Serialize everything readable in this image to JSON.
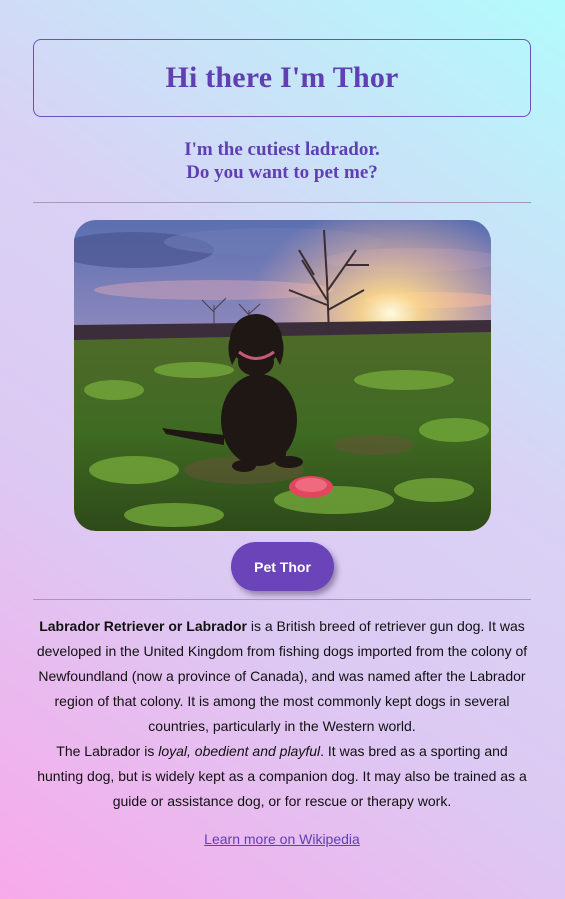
{
  "header": {
    "title": "Hi there I'm Thor"
  },
  "intro": {
    "line1": "I'm the cutiest ladrador.",
    "line2": "Do you want to pet me?"
  },
  "photo": {
    "subject": "black labrador puppy sitting in a field at sunset with a red frisbee"
  },
  "button": {
    "label": "Pet Thor"
  },
  "description": {
    "p1_bold": "Labrador Retriever or Labrador",
    "p1_rest": " is a British breed of retriever gun dog. It was developed in the United Kingdom from fishing dogs imported from the colony of Newfoundland (now a province of Canada), and was named after the Labrador region of that colony. It is among the most commonly kept dogs in several countries, particularly in the Western world.",
    "p2_start": "The Labrador is ",
    "p2_italic": "loyal, obedient and playful",
    "p2_rest": ". It was bred as a sporting and hunting dog, but is widely kept as a companion dog. It may also be trained as a guide or assistance dog, or for rescue or therapy work."
  },
  "link": {
    "label": "Learn more on Wikipedia"
  },
  "colors": {
    "accent": "#6a44b8",
    "heading": "#5f3fb3"
  }
}
